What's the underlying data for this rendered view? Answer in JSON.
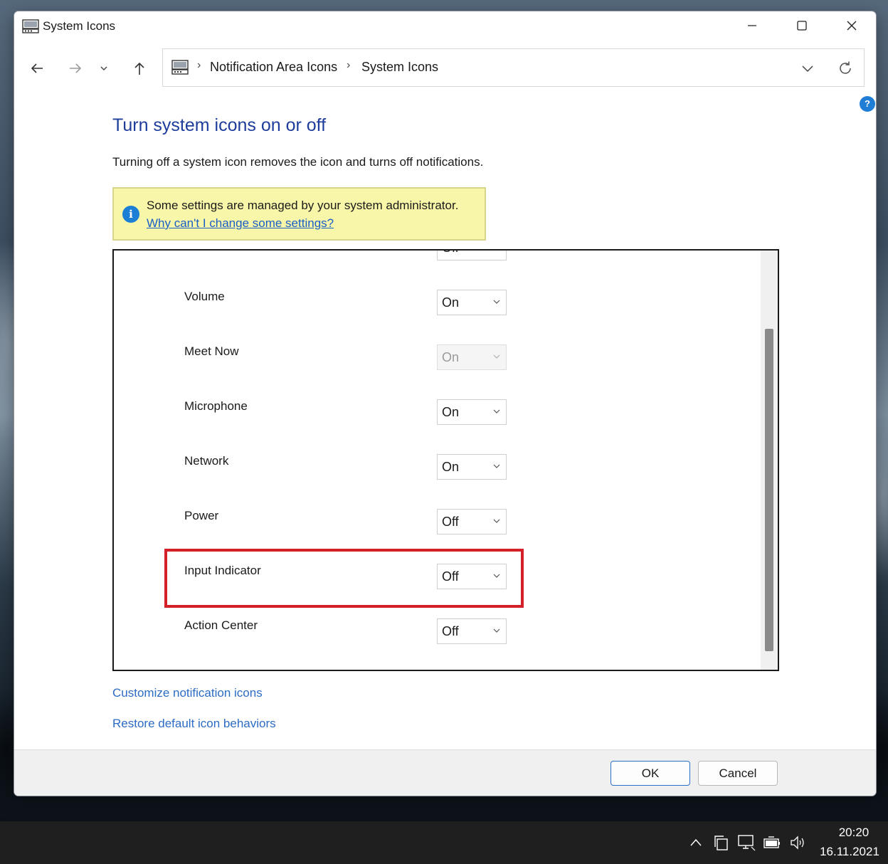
{
  "window": {
    "title": "System Icons",
    "controls": [
      "minimize-icon",
      "maximize-icon",
      "close-icon"
    ]
  },
  "navigation": {
    "buttons": [
      "back-arrow-icon",
      "forward-arrow-icon",
      "recent-locations-icon",
      "up-arrow-icon"
    ],
    "breadcrumb": [
      "Notification Area Icons",
      "System Icons"
    ],
    "separator": "›"
  },
  "help": {
    "label": "?"
  },
  "main": {
    "title": "Turn system icons on or off",
    "description": "Turning off a system icon removes the icon and turns off notifications.",
    "admin_notice": {
      "text": "Some settings are managed by your system administrator.",
      "link": "Why can't I change some settings?",
      "icon": "i"
    },
    "partial_row": {
      "value": "Off"
    },
    "icons": [
      {
        "label": "Volume",
        "value": "On",
        "enabled": true
      },
      {
        "label": "Meet Now",
        "value": "On",
        "enabled": false
      },
      {
        "label": "Microphone",
        "value": "On",
        "enabled": true
      },
      {
        "label": "Network",
        "value": "On",
        "enabled": true
      },
      {
        "label": "Power",
        "value": "Off",
        "enabled": true
      },
      {
        "label": "Input Indicator",
        "value": "Off",
        "enabled": true,
        "highlighted": true
      },
      {
        "label": "Action Center",
        "value": "Off",
        "enabled": true
      }
    ],
    "links": {
      "customize": "Customize notification icons",
      "restore": "Restore default icon behaviors"
    }
  },
  "footer": {
    "ok_label": "OK",
    "cancel_label": "Cancel"
  },
  "taskbar": {
    "tray_icons": [
      "show-hidden-icons-icon",
      "task-view-icon",
      "network-icon",
      "battery-icon",
      "volume-icon"
    ],
    "time": "20:20",
    "date": "16.11.2021"
  },
  "colors": {
    "title_blue": "#1e3d9b",
    "link_blue": "#2c6cc4",
    "notice_yellow": "#f8f6a8",
    "highlight_red": "#d32029"
  }
}
